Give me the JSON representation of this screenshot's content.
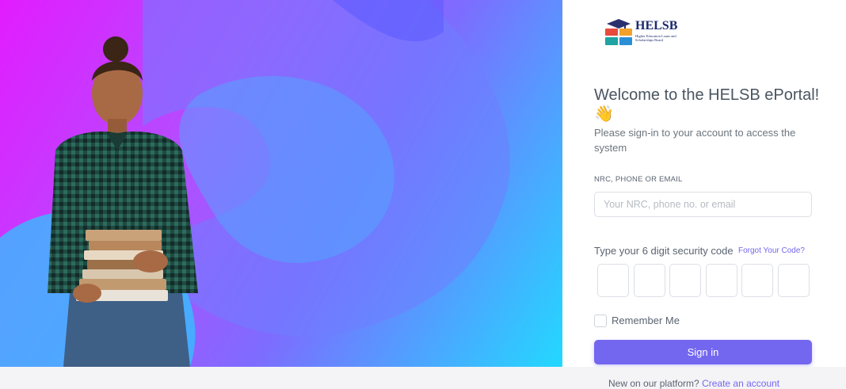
{
  "brand": {
    "logo_title": "HELSB",
    "logo_subtitle": "Higher Education Loans and Scholarships Board"
  },
  "login": {
    "welcome": "Welcome to the HELSB ePortal! 👋",
    "subtitle": "Please sign-in to your account to access the system",
    "id_label": "NRC, PHONE OR EMAIL",
    "id_placeholder": "Your NRC, phone no. or email",
    "id_value": "",
    "code_label": "Type your 6 digit security code",
    "forgot_link": "Forgot Your Code?",
    "code_digits": [
      "",
      "",
      "",
      "",
      "",
      ""
    ],
    "remember_label": "Remember Me",
    "remember_checked": false,
    "signin_label": "Sign in",
    "new_prompt": "New on our platform?",
    "create_link": "Create an account"
  },
  "colors": {
    "accent": "#7367f0",
    "hero_magenta": "#e21cff",
    "hero_cyan": "#23d8ff"
  }
}
